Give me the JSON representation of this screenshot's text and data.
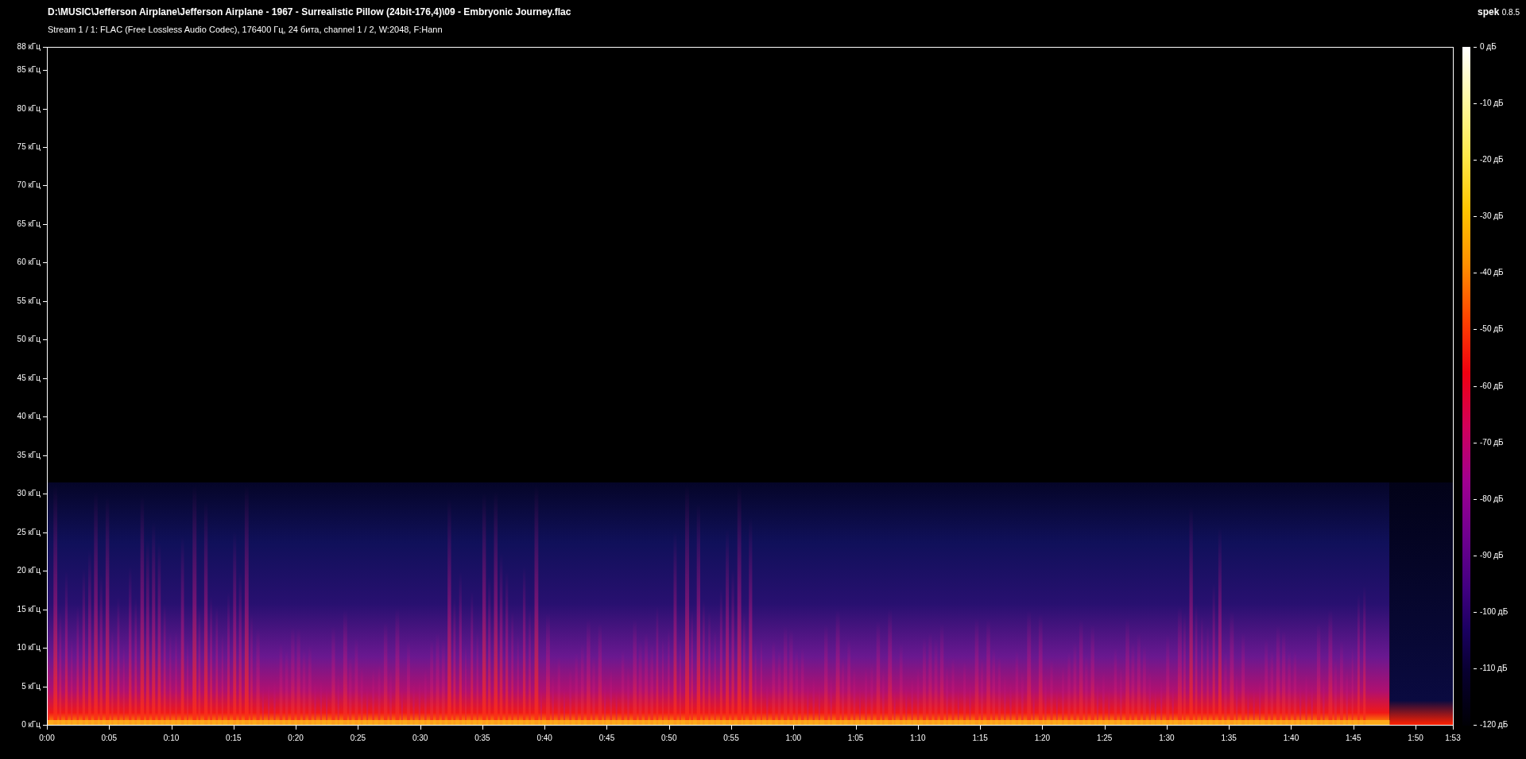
{
  "title": "D:\\MUSIC\\Jefferson Airplane\\Jefferson Airplane - 1967 - Surrealistic Pillow (24bit-176,4)\\09 - Embryonic Journey.flac",
  "stream_info": "Stream 1 / 1: FLAC (Free Lossless Audio Codec), 176400 Гц, 24 бита, channel 1 / 2, W:2048, F:Hann",
  "app": {
    "name": "spek",
    "version": "0.8.5"
  },
  "frequency_axis": {
    "ticks": [
      "88 кГц",
      "85 кГц",
      "80 кГц",
      "75 кГц",
      "70 кГц",
      "65 кГц",
      "60 кГц",
      "55 кГц",
      "50 кГц",
      "45 кГц",
      "40 кГц",
      "35 кГц",
      "30 кГц",
      "25 кГц",
      "20 кГц",
      "15 кГц",
      "10 кГц",
      "5 кГц",
      "0 кГц"
    ]
  },
  "time_axis": {
    "ticks": [
      "0:00",
      "0:05",
      "0:10",
      "0:15",
      "0:20",
      "0:25",
      "0:30",
      "0:35",
      "0:40",
      "0:45",
      "0:50",
      "0:55",
      "1:00",
      "1:05",
      "1:10",
      "1:15",
      "1:20",
      "1:25",
      "1:30",
      "1:35",
      "1:40",
      "1:45",
      "1:50",
      "1:53"
    ]
  },
  "level_scale": {
    "ticks": [
      "0 дБ",
      "-10 дБ",
      "-20 дБ",
      "-30 дБ",
      "-40 дБ",
      "-50 дБ",
      "-60 дБ",
      "-70 дБ",
      "-80 дБ",
      "-90 дБ",
      "-100 дБ",
      "-110 дБ",
      "-120 дБ"
    ]
  }
}
